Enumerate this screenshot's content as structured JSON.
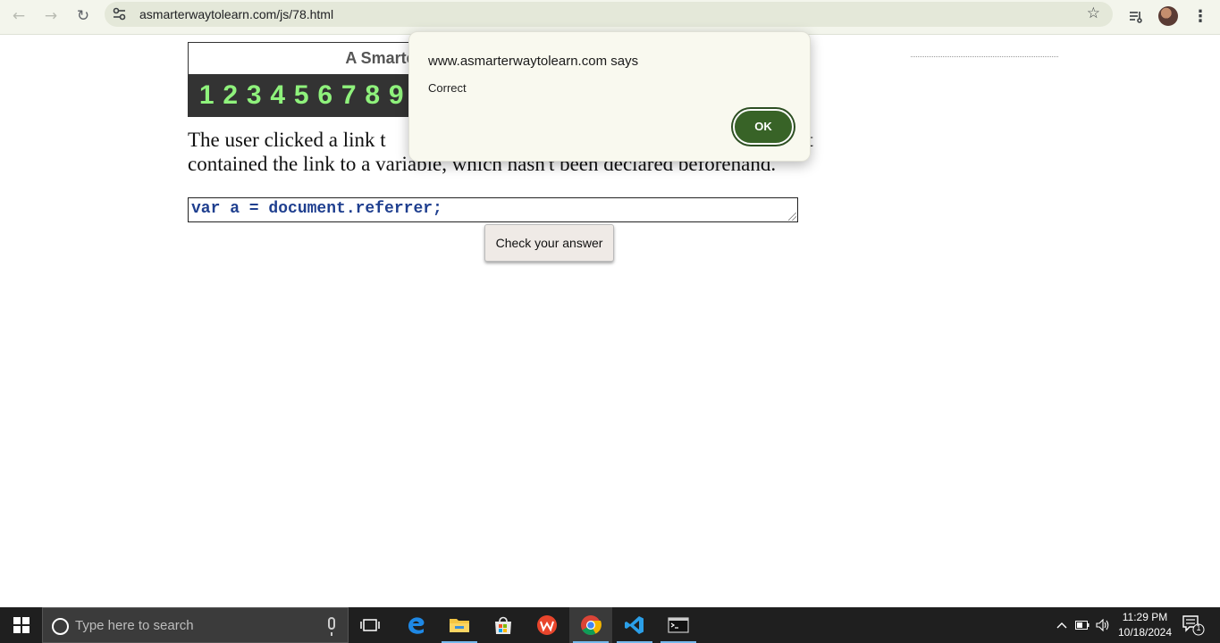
{
  "browser": {
    "url": "asmarterwaytolearn.com/js/78.html",
    "back_icon": "←",
    "forward_icon": "→",
    "reload_icon": "↻",
    "star_icon": "☆",
    "menu_icon": "⋮"
  },
  "page": {
    "site_title": "A Smarter W",
    "numbers": [
      "1",
      "2",
      "3",
      "4",
      "5",
      "6",
      "7",
      "8",
      "9"
    ],
    "question_line1": "The user clicked a link t",
    "question_line1_end": "hat",
    "question_line2": "contained the link to a variable, which hasn't been declared beforehand.",
    "answer_value": "var a = document.referrer;",
    "check_button": "Check your answer"
  },
  "dialog": {
    "title": "www.asmarterwaytolearn.com says",
    "message": "Correct",
    "ok_label": "OK"
  },
  "taskbar": {
    "search_placeholder": "Type here to search",
    "time": "11:29 PM",
    "date": "10/18/2024",
    "notification_count": "1"
  },
  "colors": {
    "chrome_bg": "#f3f5ec",
    "number_bar_bg": "#333333",
    "number_color": "#8ff27c",
    "answer_text": "#1f3f8f",
    "ok_button": "#386327"
  }
}
